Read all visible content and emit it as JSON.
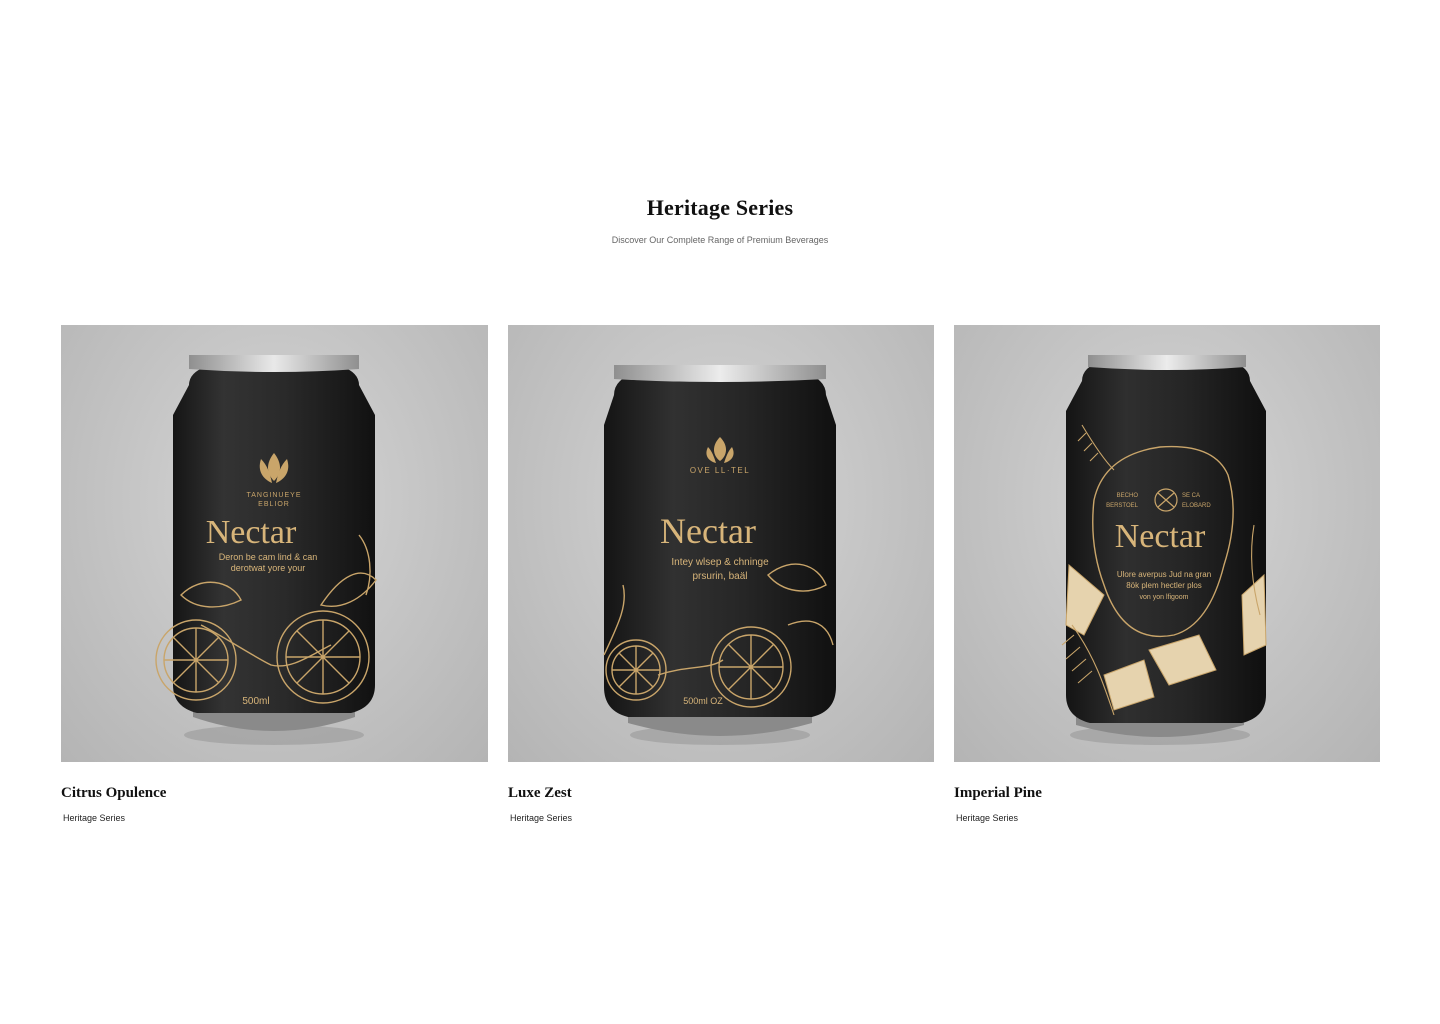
{
  "header": {
    "title": "Heritage Series",
    "subtitle": "Discover Our Complete Range of Premium Beverages"
  },
  "colors": {
    "can": "#2a2a2a",
    "gold": "#c9a56a",
    "pale_gold": "#e6d3ae",
    "backdrop": "#c3c3c3"
  },
  "products": [
    {
      "name": "Citrus Opulence",
      "collection": "Heritage Series",
      "can": {
        "brand": "Nectar",
        "badge_line1": "TANGINUEYE",
        "badge_line2": "EBLIOR",
        "tagline_1": "Deron be cam lind & can",
        "tagline_2": "derotwat yore your",
        "volume": "500ml",
        "icon": "lotus-icon",
        "art": "orange-slices-and-leaves"
      }
    },
    {
      "name": "Luxe Zest",
      "collection": "Heritage Series",
      "can": {
        "brand": "Nectar",
        "badge_line1": "OVE LL·TEL",
        "tagline_1": "Intey wlsep & chninge",
        "tagline_2": "prsurin, baäl",
        "volume": "500ml OZ",
        "icon": "leaf-icon",
        "art": "lemon-slices-and-leaves"
      }
    },
    {
      "name": "Imperial Pine",
      "collection": "Heritage Series",
      "can": {
        "brand": "Nectar",
        "badge_left_1": "BECHO",
        "badge_left_2": "BERSTOEL",
        "badge_right_1": "SE CA",
        "badge_right_2": "ELOBARD",
        "tagline_1": "Ulore averpus Jud na gran",
        "tagline_2": "8ök plem hectler plos",
        "tagline_3": "von yon lfigoom",
        "icon": "knot-emblem-icon",
        "art": "pineapple-and-palm-leaves"
      }
    }
  ]
}
